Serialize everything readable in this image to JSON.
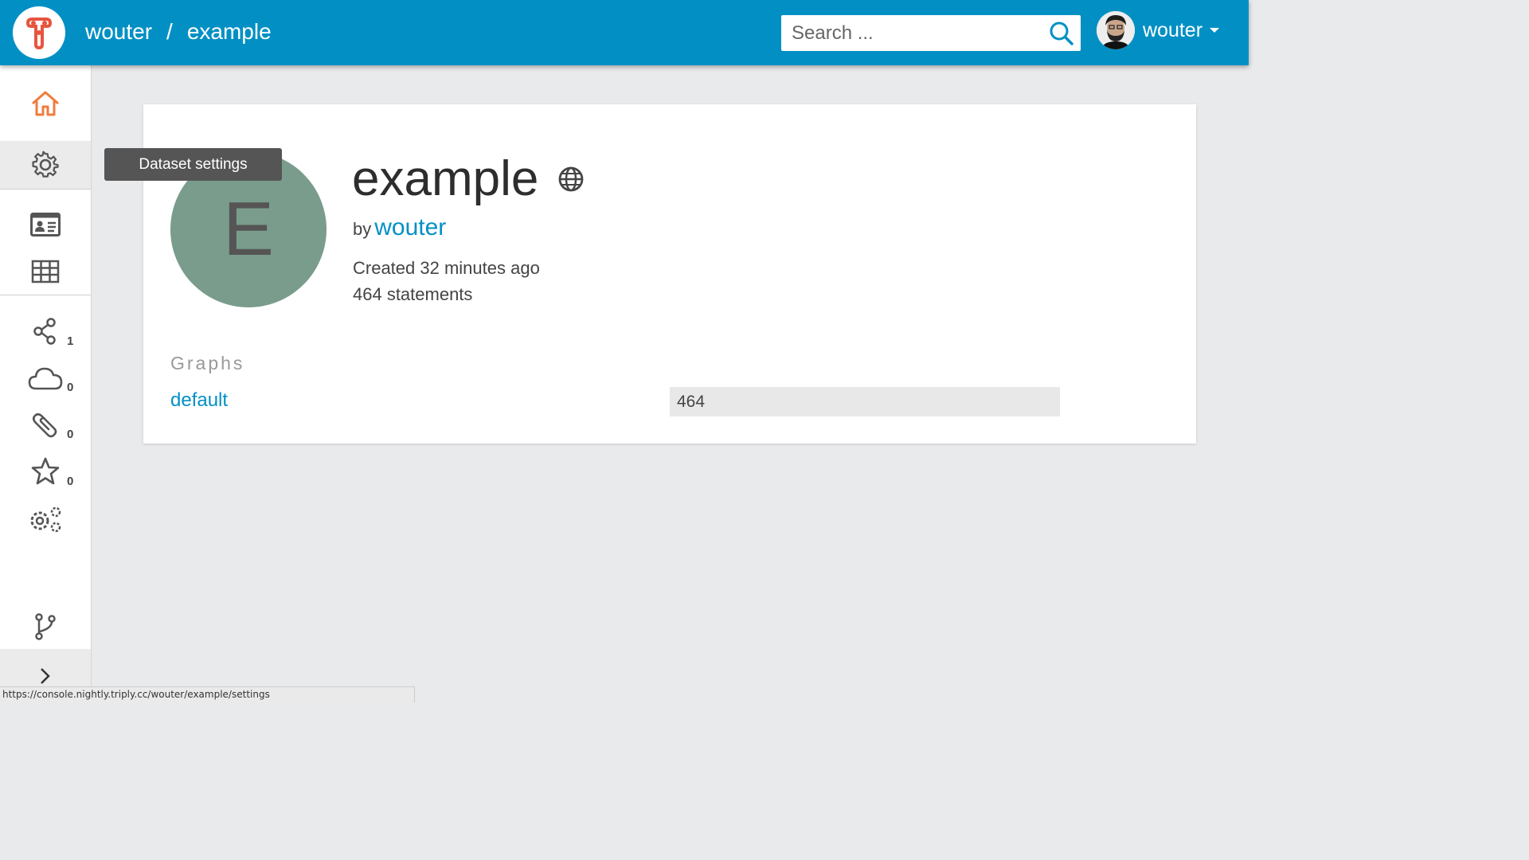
{
  "header": {
    "breadcrumbs": [
      "wouter",
      "example"
    ],
    "separator": "/",
    "search_placeholder": "Search ...",
    "user_name": "wouter",
    "brand_color": "#0290c4",
    "logo_color": "#e8543e"
  },
  "sidebar": {
    "items": [
      {
        "icon": "home-icon",
        "active": false
      },
      {
        "icon": "gear-icon",
        "active": true
      },
      {
        "icon": "id-card-icon"
      },
      {
        "icon": "table-icon"
      },
      {
        "icon": "share-icon",
        "count": "1"
      },
      {
        "icon": "cloud-icon",
        "count": "0"
      },
      {
        "icon": "paperclip-icon",
        "count": "0"
      },
      {
        "icon": "star-icon",
        "count": "0"
      },
      {
        "icon": "gears-icon"
      },
      {
        "icon": "branch-icon"
      },
      {
        "icon": "chevron-right-icon"
      }
    ]
  },
  "tooltip": "Dataset settings",
  "dataset": {
    "initial": "E",
    "title": "example",
    "by_prefix": "by",
    "owner": "wouter",
    "created": "Created 32 minutes ago",
    "statements": "464 statements",
    "avatar_color": "#7a9c8c"
  },
  "graphs": {
    "heading": "Graphs",
    "rows": [
      {
        "name": "default",
        "count": "464",
        "fraction": 1.0
      }
    ]
  },
  "statusbar": "https://console.nightly.triply.cc/wouter/example/settings"
}
